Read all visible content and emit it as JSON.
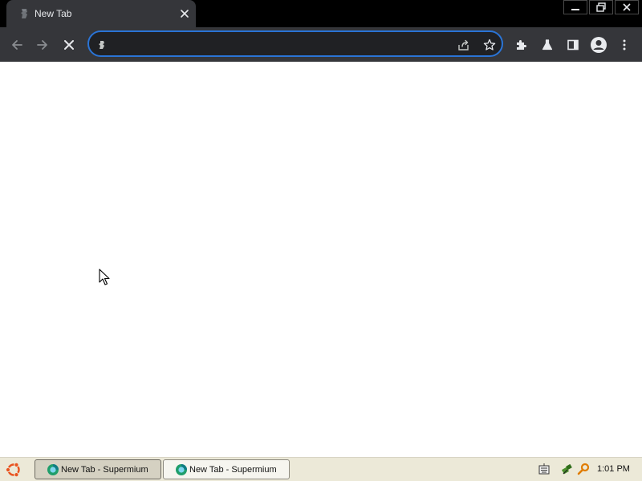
{
  "browser": {
    "tab": {
      "title": "New Tab",
      "favicon": "page-loading-icon",
      "close_icon": "close-icon"
    },
    "window_controls": [
      "minimize-icon",
      "restore-icon",
      "close-icon"
    ],
    "toolbar": {
      "back_icon": "back-arrow-icon",
      "forward_icon": "forward-arrow-icon",
      "stop_icon": "stop-loading-icon",
      "omnibox": {
        "value": "",
        "placeholder": "",
        "site_icon": "search-engine-icon",
        "share_icon": "share-icon",
        "bookmark_icon": "star-icon"
      },
      "extensions_icon": "puzzle-icon",
      "labs_icon": "flask-icon",
      "side_panel_icon": "side-panel-icon",
      "profile_icon": "avatar-icon",
      "menu_icon": "kebab-menu-icon"
    },
    "accent_color": "#2a74d6",
    "toolbar_color": "#35363a"
  },
  "taskbar": {
    "start_icon": "ubuntu-logo-icon",
    "items": [
      {
        "label": "New Tab - Supermium",
        "icon": "supermium-icon",
        "active": true
      },
      {
        "label": "New Tab - Supermium",
        "icon": "supermium-icon",
        "active": false
      }
    ],
    "tray": [
      "keyboard-icon",
      "network-icon",
      "search-key-icon"
    ],
    "clock": "1:01 PM"
  }
}
